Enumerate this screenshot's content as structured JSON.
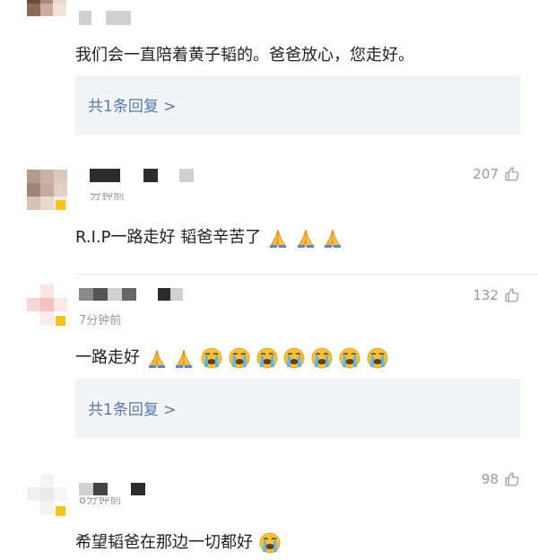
{
  "comments": [
    {
      "text": "我们会一直陪着黄子韬的。爸爸放心，您走好。",
      "reply_label": "共1条回复 >"
    },
    {
      "likes": "207",
      "time": "分钟前",
      "text": "R.I.P一路走好 韬爸辛苦了",
      "emoji": [
        "folded-hands",
        "folded-hands",
        "folded-hands"
      ]
    },
    {
      "likes": "132",
      "time": "7分钟前",
      "text": "一路走好",
      "emoji": [
        "folded-hands",
        "folded-hands",
        "crying-face",
        "crying-face",
        "crying-face",
        "crying-face",
        "crying-face",
        "crying-face",
        "crying-face"
      ],
      "reply_label": "共1条回复 >"
    },
    {
      "likes": "98",
      "time": "8分钟前",
      "text": "希望韬爸在那边一切都好",
      "emoji": [
        "crying-face"
      ]
    }
  ],
  "colors": {
    "link": "#5678a8",
    "badge": "#f6c51c",
    "reply_bg": "#f3f4f6"
  }
}
